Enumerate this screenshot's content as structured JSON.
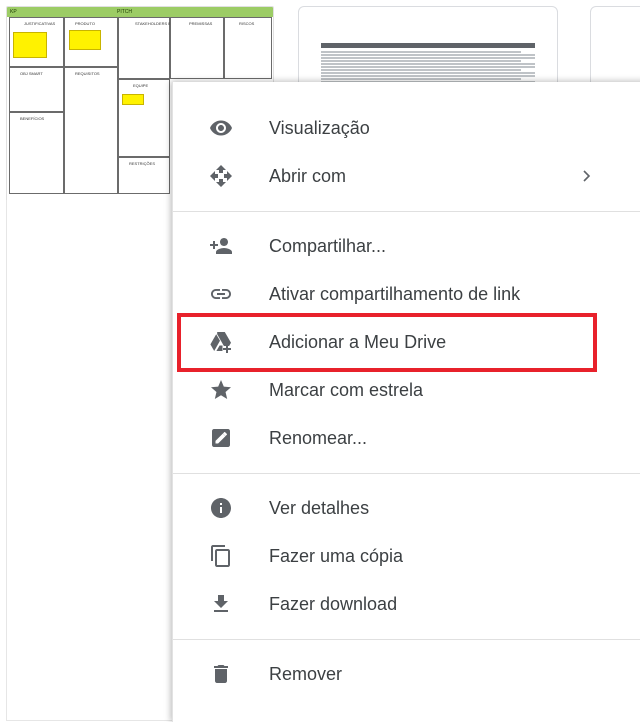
{
  "files": {
    "canvas_card": {
      "header_labels": [
        "KP",
        "PITCH"
      ],
      "cell_labels": [
        "JUSTIFICATIVAS",
        "PRODUTO",
        "STAKEHOLDERS EXTERNOS",
        "PREMISSAS",
        "RISCOS",
        "OBJ SMART",
        "REQUISITOS",
        "EQUIPE",
        "BENEFÍCIOS",
        "RESTRIÇÕES"
      ]
    }
  },
  "context_menu": {
    "items": [
      {
        "id": "preview",
        "label": "Visualização",
        "icon": "eye-icon"
      },
      {
        "id": "open_with",
        "label": "Abrir com",
        "icon": "open-with-icon",
        "submenu": true
      },
      {
        "id": "share",
        "label": "Compartilhar...",
        "icon": "person-add-icon"
      },
      {
        "id": "link_share",
        "label": "Ativar compartilhamento de link",
        "icon": "link-icon"
      },
      {
        "id": "add_to_drive",
        "label": "Adicionar a Meu Drive",
        "icon": "drive-add-icon",
        "highlighted": true
      },
      {
        "id": "star",
        "label": "Marcar com estrela",
        "icon": "star-icon"
      },
      {
        "id": "rename",
        "label": "Renomear...",
        "icon": "rename-icon"
      },
      {
        "id": "details",
        "label": "Ver detalhes",
        "icon": "info-icon"
      },
      {
        "id": "copy",
        "label": "Fazer uma cópia",
        "icon": "copy-icon"
      },
      {
        "id": "download",
        "label": "Fazer download",
        "icon": "download-icon"
      },
      {
        "id": "remove",
        "label": "Remover",
        "icon": "trash-icon"
      }
    ]
  },
  "colors": {
    "icon": "#5f6368",
    "text": "#3c4043",
    "highlight": "#e8212b",
    "postit": "#fff200",
    "canvas_header": "#9ccc65"
  }
}
